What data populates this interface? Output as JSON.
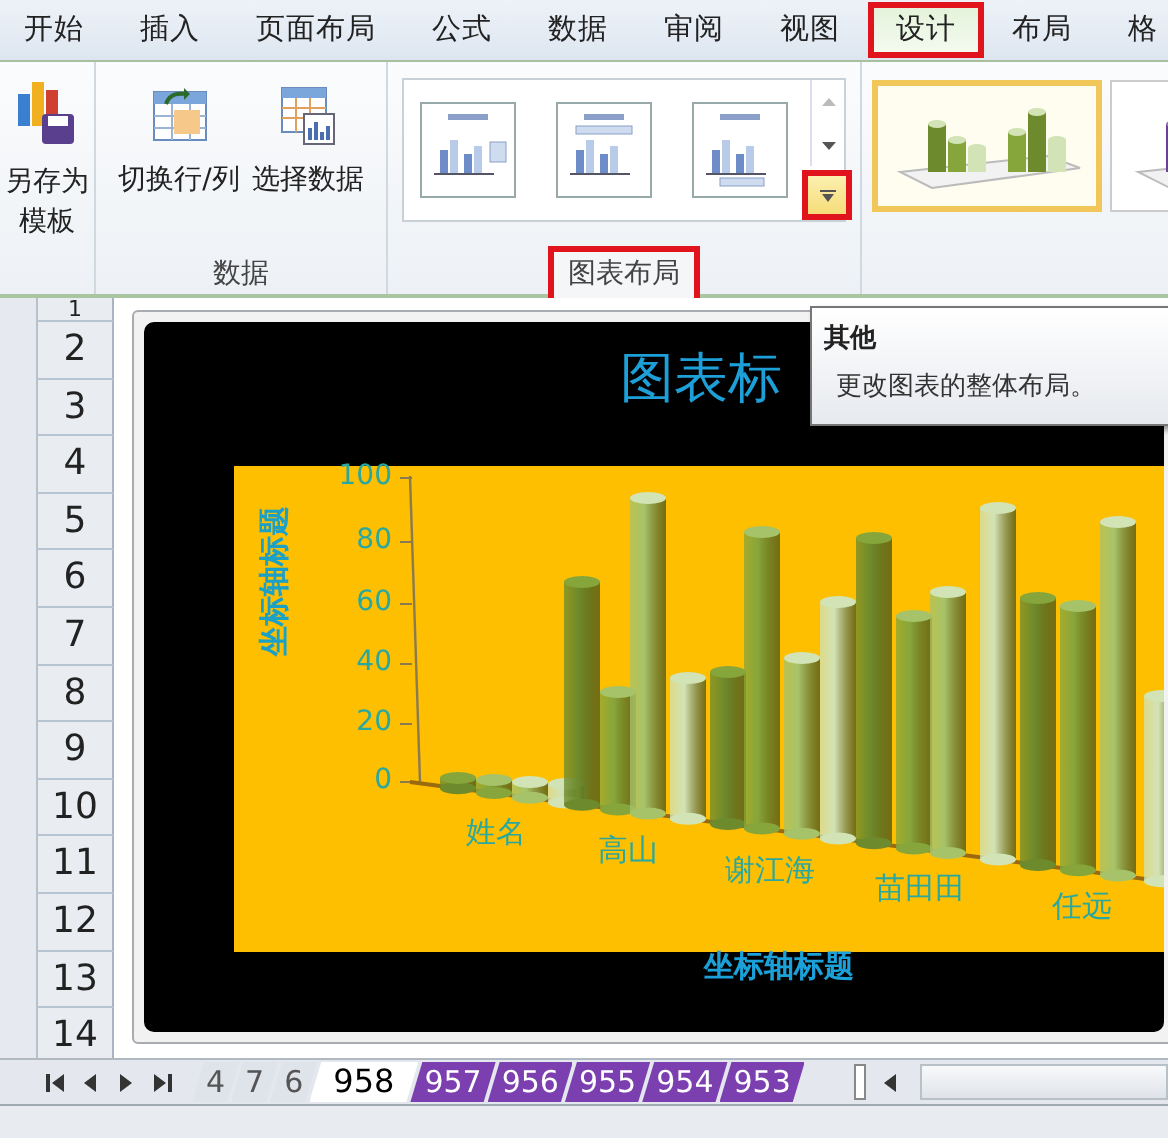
{
  "ribbon_tabs": [
    {
      "label": "开始",
      "selected": false,
      "highlighted": false
    },
    {
      "label": "插入",
      "selected": false,
      "highlighted": false
    },
    {
      "label": "页面布局",
      "selected": false,
      "highlighted": false
    },
    {
      "label": "公式",
      "selected": false,
      "highlighted": false
    },
    {
      "label": "数据",
      "selected": false,
      "highlighted": false
    },
    {
      "label": "审阅",
      "selected": false,
      "highlighted": false
    },
    {
      "label": "视图",
      "selected": false,
      "highlighted": false
    },
    {
      "label": "设计",
      "selected": true,
      "highlighted": true
    },
    {
      "label": "布局",
      "selected": false,
      "highlighted": false
    },
    {
      "label": "格",
      "selected": false,
      "highlighted": false
    }
  ],
  "save_template_button": {
    "label": "另存为模板"
  },
  "data_group": {
    "label": "数据",
    "buttons": [
      {
        "label": "切换行/列",
        "kind": "switch"
      },
      {
        "label": "选择数据",
        "kind": "select"
      }
    ]
  },
  "layout_group": {
    "label": "图表布局",
    "highlighted": true,
    "more_button": {
      "highlighted": true
    },
    "layouts": [
      {
        "selected": false
      },
      {
        "selected": false
      },
      {
        "selected": false
      }
    ]
  },
  "style_gallery": [
    {
      "selected": true
    },
    {
      "selected": false
    }
  ],
  "tooltip": {
    "title": "其他",
    "text": "更改图表的整体布局。"
  },
  "row_headers": [
    "1",
    "2",
    "3",
    "4",
    "5",
    "6",
    "7",
    "8",
    "9",
    "10",
    "11",
    "12",
    "13",
    "14"
  ],
  "chart": {
    "title": "图表标",
    "y_axis_title": "坐标轴标题",
    "x_axis_title": "坐标轴标题",
    "y_ticks": [
      "100",
      "80",
      "60",
      "40",
      "20",
      "0"
    ],
    "categories": [
      "姓名",
      "高山",
      "谢江海",
      "苗田田",
      "任远"
    ]
  },
  "sheet_tabs": [
    {
      "label": "4",
      "selected": false
    },
    {
      "label": "7",
      "selected": false
    },
    {
      "label": "6",
      "selected": false
    },
    {
      "label": "958",
      "selected": true
    },
    {
      "label": "957",
      "selected": false,
      "color": "#7b3fb0"
    },
    {
      "label": "956",
      "selected": false,
      "color": "#7b3fb0"
    },
    {
      "label": "955",
      "selected": false,
      "color": "#7b3fb0"
    },
    {
      "label": "954",
      "selected": false,
      "color": "#7b3fb0"
    },
    {
      "label": "953",
      "selected": false,
      "color": "#7b3fb0"
    }
  ]
}
